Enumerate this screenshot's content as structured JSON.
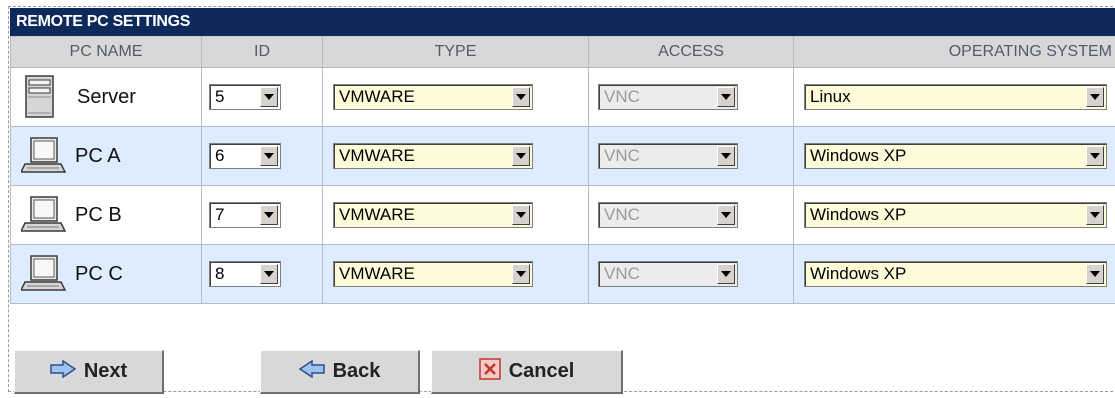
{
  "title": "REMOTE PC SETTINGS",
  "columns": [
    "PC NAME",
    "ID",
    "TYPE",
    "ACCESS",
    "OPERATING SYSTEM"
  ],
  "rows": [
    {
      "name": "Server",
      "icon": "server-icon",
      "id": "5",
      "type": "VMWARE",
      "access": "VNC",
      "os": "Linux"
    },
    {
      "name": "PC A",
      "icon": "computer-icon",
      "id": "6",
      "type": "VMWARE",
      "access": "VNC",
      "os": "Windows XP"
    },
    {
      "name": "PC B",
      "icon": "computer-icon",
      "id": "7",
      "type": "VMWARE",
      "access": "VNC",
      "os": "Windows XP"
    },
    {
      "name": "PC C",
      "icon": "computer-icon",
      "id": "8",
      "type": "VMWARE",
      "access": "VNC",
      "os": "Windows XP"
    }
  ],
  "buttons": {
    "next": "Next",
    "back": "Back",
    "cancel": "Cancel"
  },
  "colors": {
    "title_bar": "#0e2a5c",
    "header_bg": "#d8d8d8",
    "row_alt": "#deecff",
    "select_bg": "#fdfbd8"
  }
}
